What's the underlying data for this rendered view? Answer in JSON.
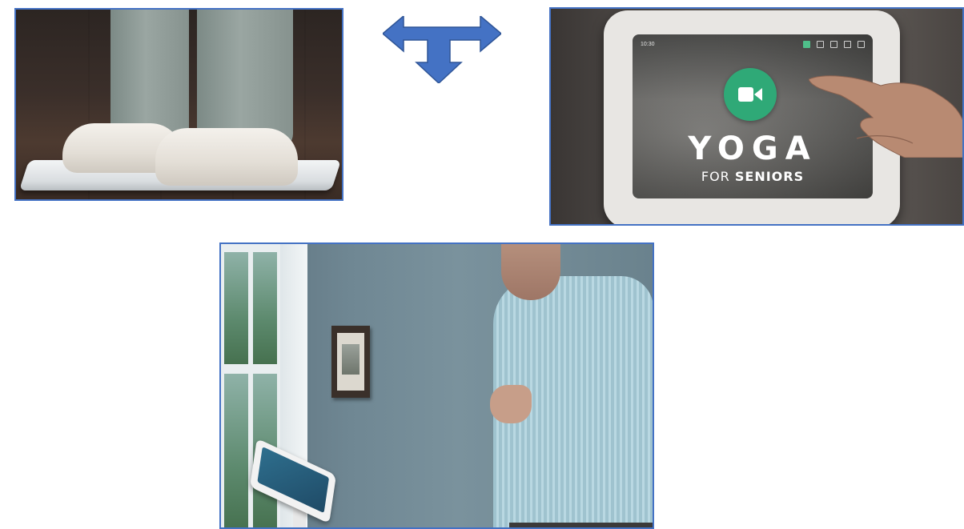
{
  "panels": {
    "feet": {
      "description_label": ""
    },
    "device": {
      "title": "YOGA",
      "subtitle_prefix": "FOR",
      "subtitle_emphasis": "SENIORS",
      "status_time": "10:30"
    },
    "man": {
      "description_label": ""
    }
  },
  "icons": {
    "arrow": "t-shaped-double-arrow-icon",
    "video": "video-camera-icon"
  },
  "colors": {
    "frame": "#4472c4",
    "arrow_fill": "#4472c4",
    "video_button": "#2fa977"
  }
}
